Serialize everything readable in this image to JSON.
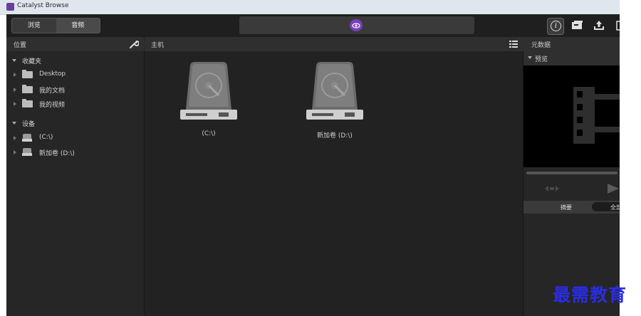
{
  "window": {
    "title": "Catalyst Browse"
  },
  "toolbar": {
    "segment": [
      "浏览",
      "音频"
    ],
    "info_label": "i"
  },
  "left_panel": {
    "header": "位置",
    "groups": [
      {
        "label": "收藏夹",
        "items": [
          {
            "label": "Desktop"
          },
          {
            "label": "我的文档"
          },
          {
            "label": "我的视频"
          }
        ]
      },
      {
        "label": "设备",
        "items": [
          {
            "label": "(C:\\)"
          },
          {
            "label": "新加卷 (D:\\)"
          }
        ]
      }
    ]
  },
  "middle_panel": {
    "header": "主机",
    "drives": [
      {
        "label": "(C:\\)"
      },
      {
        "label": "新加卷 (D:\\)"
      }
    ]
  },
  "right_panel": {
    "header": "元数据",
    "section": "预览",
    "tabs": [
      "摘要",
      "全部"
    ]
  },
  "watermark": "最需教育",
  "colors": {
    "accent": "#7a3fb8",
    "watermark": "#2a2de0"
  }
}
